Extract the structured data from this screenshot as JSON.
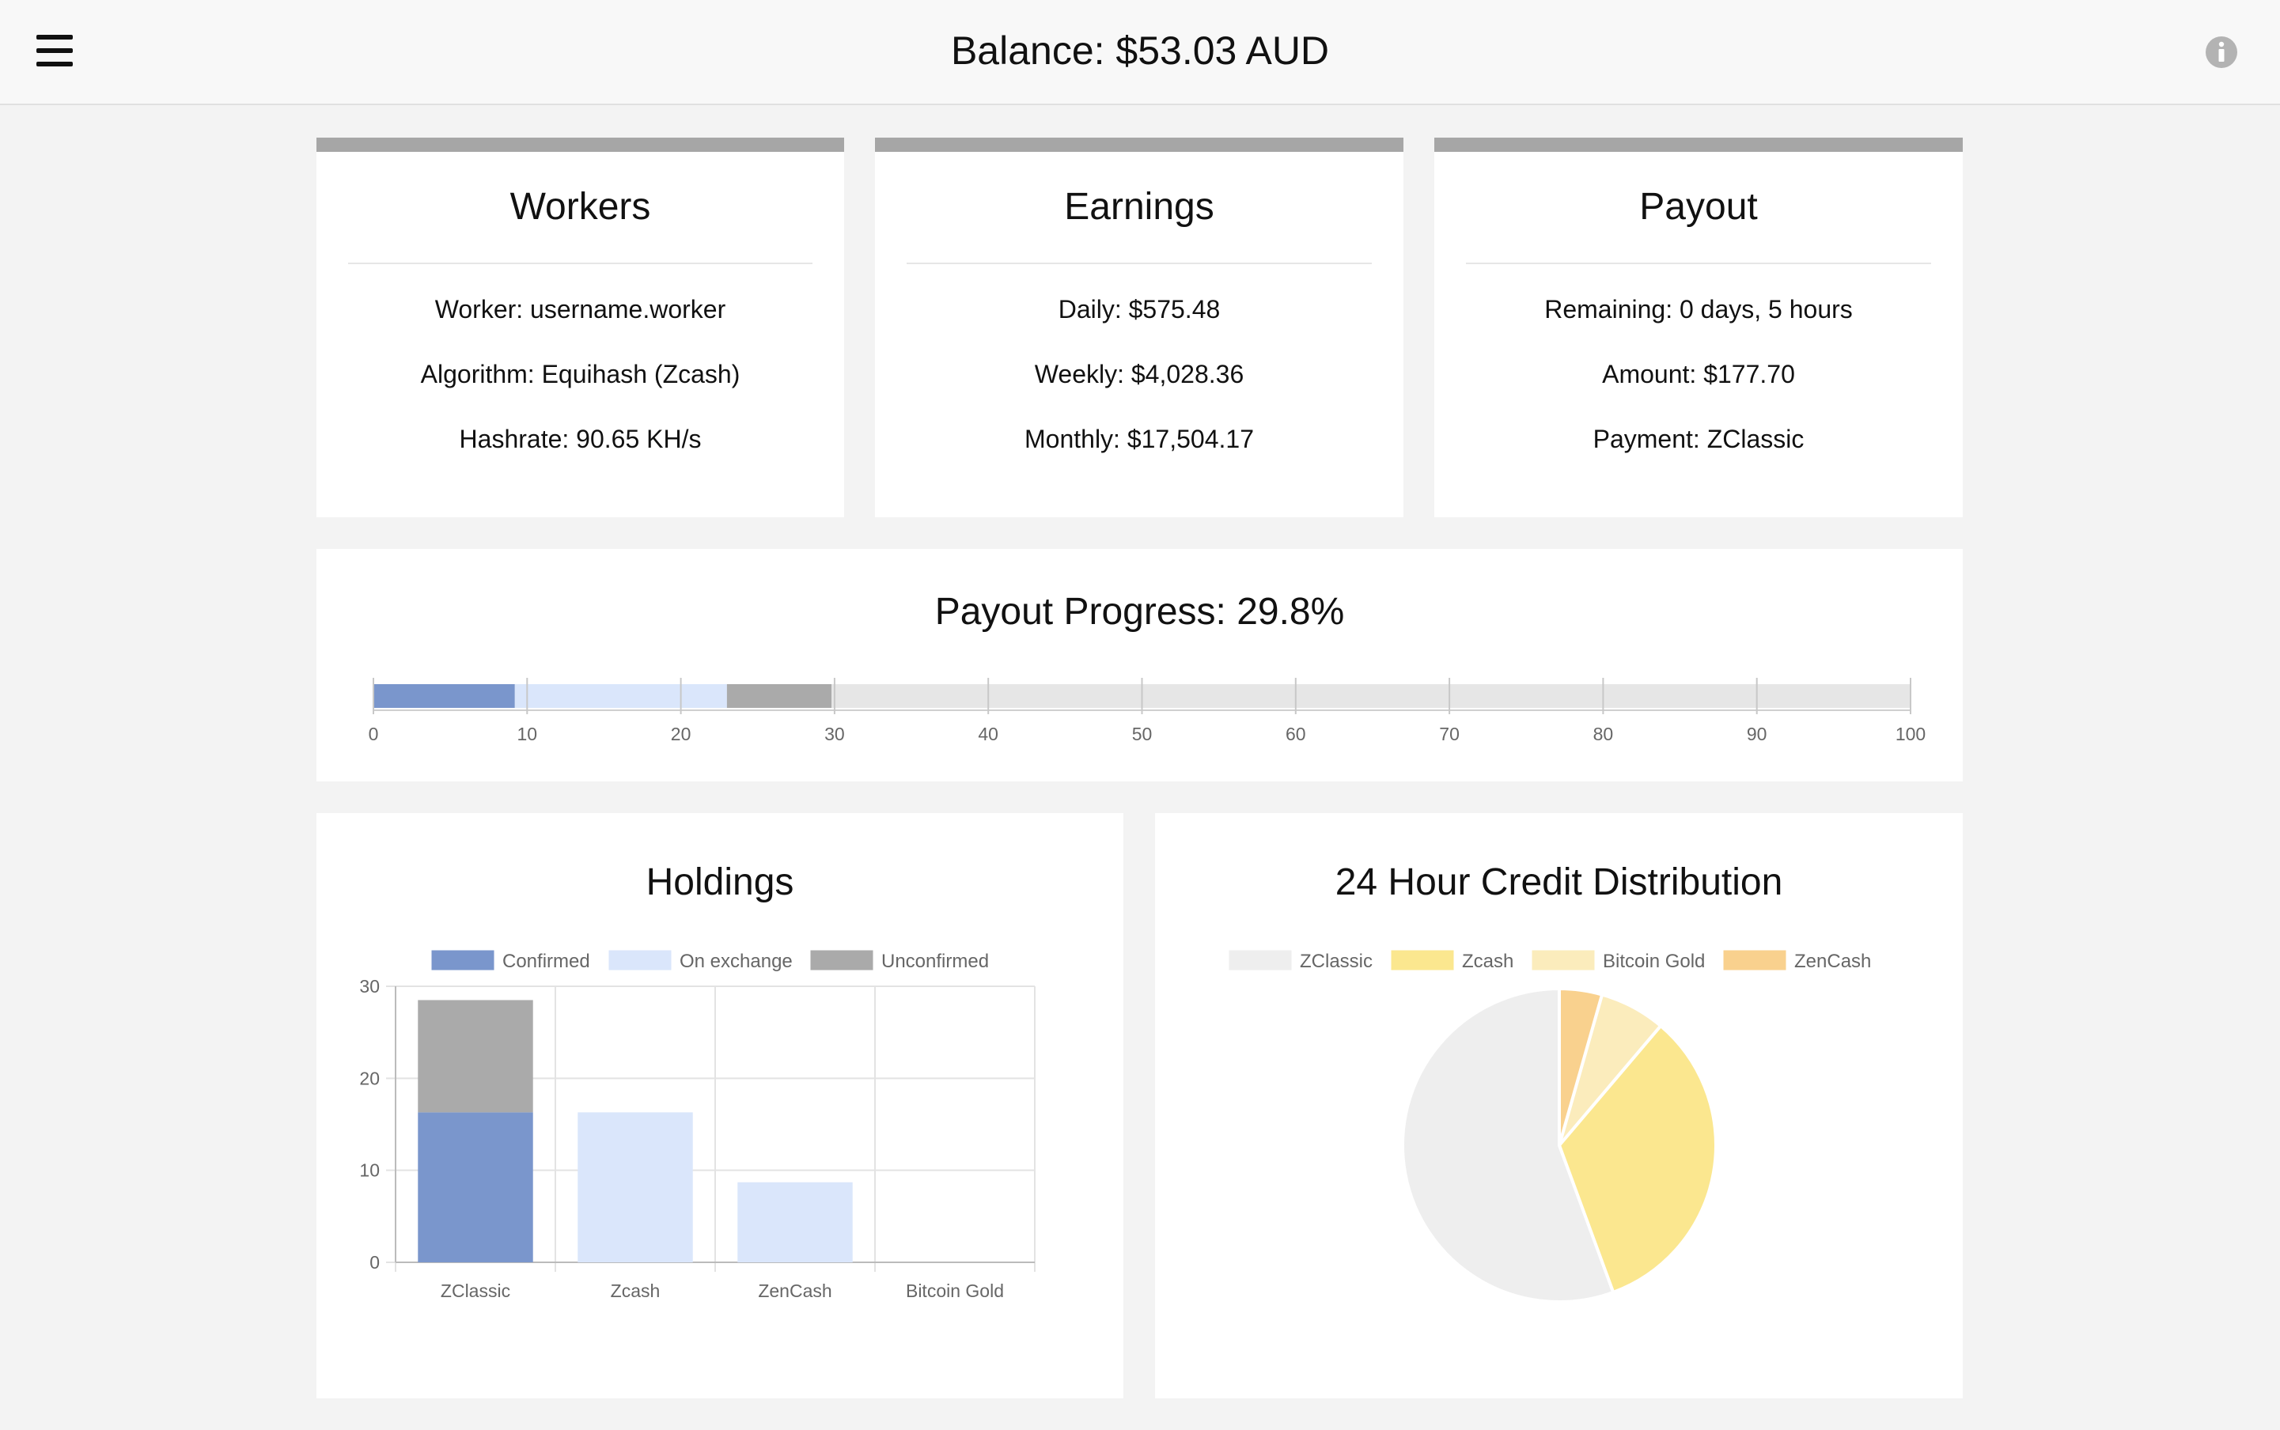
{
  "header": {
    "balance_text": "Balance: $53.03 AUD",
    "menu_icon": "hamburger-menu-icon",
    "info_icon": "info-icon"
  },
  "workers": {
    "title": "Workers",
    "worker": "Worker: username.worker",
    "algorithm": "Algorithm: Equihash (Zcash)",
    "hashrate": "Hashrate: 90.65 KH/s"
  },
  "earnings": {
    "title": "Earnings",
    "daily": "Daily: $575.48",
    "weekly": "Weekly: $4,028.36",
    "monthly": "Monthly: $17,504.17"
  },
  "payout": {
    "title": "Payout",
    "remaining": "Remaining: 0 days, 5 hours",
    "amount": "Amount: $177.70",
    "payment": "Payment: ZClassic"
  },
  "progress": {
    "title": "Payout Progress: 29.8%"
  },
  "holdings": {
    "title": "Holdings"
  },
  "distribution": {
    "title": "24 Hour Credit Distribution"
  },
  "colors": {
    "confirmed": "#7a96cc",
    "on_exchange": "#dae6fb",
    "unconfirmed": "#aaaaaa",
    "track": "#e6e6e6",
    "zclassic": "#eeeeee",
    "zcash": "#fbe78f",
    "bitcoin_gold": "#fbecbc",
    "zencash": "#f9d18e"
  },
  "chart_data": [
    {
      "id": "payout-progress",
      "type": "bar",
      "orientation": "horizontal",
      "stacked": true,
      "series": [
        {
          "name": "Confirmed",
          "values": [
            9.2
          ]
        },
        {
          "name": "On exchange",
          "values": [
            13.8
          ]
        },
        {
          "name": "Unconfirmed",
          "values": [
            6.8
          ]
        }
      ],
      "xlim": [
        0,
        100
      ],
      "xticks": [
        0,
        10,
        20,
        30,
        40,
        50,
        60,
        70,
        80,
        90,
        100
      ]
    },
    {
      "id": "holdings",
      "type": "bar",
      "stacked": true,
      "categories": [
        "ZClassic",
        "Zcash",
        "ZenCash",
        "Bitcoin Gold"
      ],
      "series": [
        {
          "name": "Confirmed",
          "values": [
            16.3,
            0,
            0,
            0
          ]
        },
        {
          "name": "On exchange",
          "values": [
            0,
            16.3,
            8.7,
            0
          ]
        },
        {
          "name": "Unconfirmed",
          "values": [
            12.2,
            0,
            0,
            0
          ]
        }
      ],
      "ylim": [
        0,
        30
      ],
      "yticks": [
        0,
        10,
        20,
        30
      ],
      "legend": "top"
    },
    {
      "id": "credit-distribution",
      "type": "pie",
      "labels": [
        "ZClassic",
        "Zcash",
        "Bitcoin Gold",
        "ZenCash"
      ],
      "values": [
        55.6,
        33.2,
        6.8,
        4.4
      ],
      "legend": "top"
    }
  ]
}
